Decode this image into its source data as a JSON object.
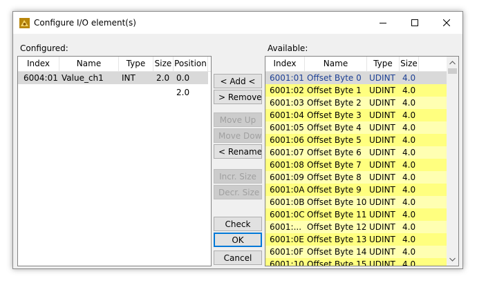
{
  "window": {
    "title": "Configure I/O element(s)"
  },
  "configured": {
    "label": "Configured:",
    "columns": [
      "Index",
      "Name",
      "Type",
      "Size",
      "Position"
    ],
    "rows": [
      {
        "index": "6004:01",
        "name": "Value_ch1",
        "type": "INT",
        "size": "2.0",
        "position": "0.0"
      }
    ],
    "next_position": "2.0"
  },
  "buttons": {
    "add": "< Add <",
    "remove": "> Remove >",
    "move_up": "Move Up",
    "move_down": "Move Down",
    "rename": "< Rename",
    "incr_size": "Incr. Size",
    "decr_size": "Decr. Size",
    "check": "Check",
    "ok": "OK",
    "cancel": "Cancel"
  },
  "available": {
    "label": "Available:",
    "columns": [
      "Index",
      "Name",
      "Type",
      "Size"
    ],
    "rows": [
      {
        "index": "6001:01",
        "name": "Offset Byte 0",
        "type": "UDINT",
        "size": "4.0"
      },
      {
        "index": "6001:02",
        "name": "Offset Byte 1",
        "type": "UDINT",
        "size": "4.0"
      },
      {
        "index": "6001:03",
        "name": "Offset Byte 2",
        "type": "UDINT",
        "size": "4.0"
      },
      {
        "index": "6001:04",
        "name": "Offset Byte 3",
        "type": "UDINT",
        "size": "4.0"
      },
      {
        "index": "6001:05",
        "name": "Offset Byte 4",
        "type": "UDINT",
        "size": "4.0"
      },
      {
        "index": "6001:06",
        "name": "Offset Byte 5",
        "type": "UDINT",
        "size": "4.0"
      },
      {
        "index": "6001:07",
        "name": "Offset Byte 6",
        "type": "UDINT",
        "size": "4.0"
      },
      {
        "index": "6001:08",
        "name": "Offset Byte 7",
        "type": "UDINT",
        "size": "4.0"
      },
      {
        "index": "6001:09",
        "name": "Offset Byte 8",
        "type": "UDINT",
        "size": "4.0"
      },
      {
        "index": "6001:0A",
        "name": "Offset Byte 9",
        "type": "UDINT",
        "size": "4.0"
      },
      {
        "index": "6001:0B",
        "name": "Offset Byte 10",
        "type": "UDINT",
        "size": "4.0"
      },
      {
        "index": "6001:0C",
        "name": "Offset Byte 11",
        "type": "UDINT",
        "size": "4.0"
      },
      {
        "index": "6001:...",
        "name": "Offset Byte 12",
        "type": "UDINT",
        "size": "4.0"
      },
      {
        "index": "6001:0E",
        "name": "Offset Byte 13",
        "type": "UDINT",
        "size": "4.0"
      },
      {
        "index": "6001:0F",
        "name": "Offset Byte 14",
        "type": "UDINT",
        "size": "4.0"
      },
      {
        "index": "6001:10",
        "name": "Offset Byte 15",
        "type": "UDINT",
        "size": "4.0"
      }
    ]
  },
  "colors": {
    "row_yellow": "#ffff7f",
    "row_yellow_alt": "#ffffb2",
    "row_selected": "#d9d9d9",
    "text_blue": "#1c3f94",
    "accent": "#0078d7"
  },
  "icons": {
    "app": "app-icon",
    "minimize": "minimize-icon",
    "maximize": "maximize-icon",
    "close": "close-icon",
    "scroll_up": "chevron-up-icon",
    "scroll_down": "chevron-down-icon"
  }
}
